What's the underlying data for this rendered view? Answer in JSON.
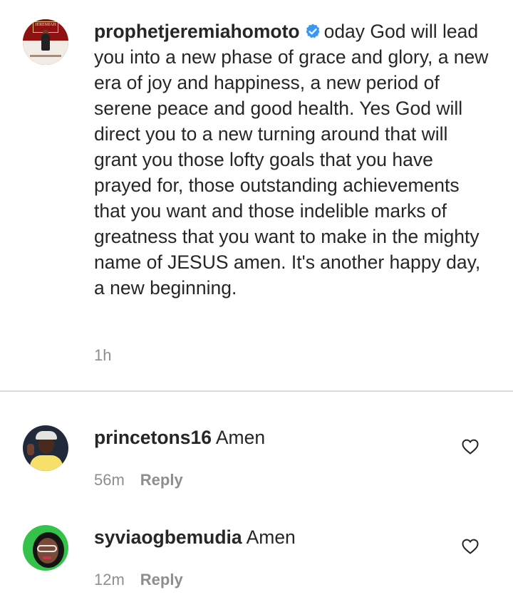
{
  "caption": {
    "username": "prophetjeremiahomoto",
    "text": "oday God will lead you into a new phase of grace and glory, a new era of joy and happiness, a new period of serene peace and good health. Yes God will direct you to a new turning around that will grant you those lofty goals that you have prayed for, those outstanding achievements that you want and those indelible marks of greatness that you want to make in the mighty name of JESUS amen. It's another happy day, a new beginning.",
    "time": "1h",
    "avatar_text": "JEREMIAH"
  },
  "comments": [
    {
      "username": "princetons16",
      "text": "Amen",
      "time": "56m",
      "reply_label": "Reply"
    },
    {
      "username": "syviaogbemudia",
      "text": "Amen",
      "time": "12m",
      "reply_label": "Reply"
    }
  ],
  "icons": {
    "verified": "verified-badge-icon",
    "like": "heart-outline-icon"
  },
  "colors": {
    "text": "#262626",
    "muted": "#8e8e8e",
    "verified": "#3897f0",
    "divider": "#dbdbdb"
  }
}
